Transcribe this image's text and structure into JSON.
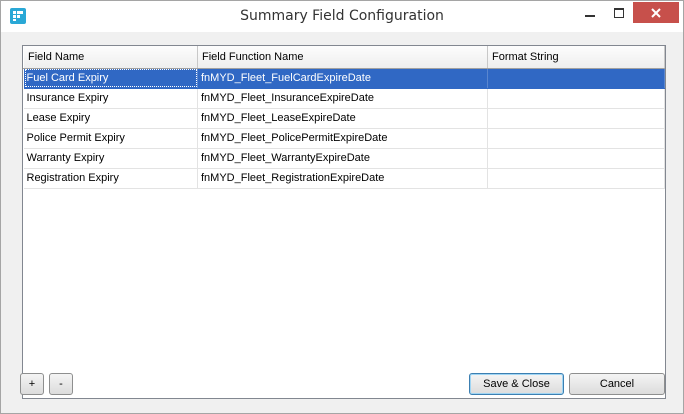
{
  "window": {
    "title": "Summary Field Configuration",
    "controls": [
      "minimize-icon",
      "maximize-icon",
      "close-icon"
    ],
    "close_button_color": "#c7504b"
  },
  "grid": {
    "columns": [
      "Field Name",
      "Field Function Name",
      "Format String"
    ],
    "rows": [
      {
        "field_name": "Fuel Card Expiry",
        "function_name": "fnMYD_Fleet_FuelCardExpireDate",
        "format": ""
      },
      {
        "field_name": "Insurance Expiry",
        "function_name": "fnMYD_Fleet_InsuranceExpireDate",
        "format": ""
      },
      {
        "field_name": "Lease Expiry",
        "function_name": "fnMYD_Fleet_LeaseExpireDate",
        "format": ""
      },
      {
        "field_name": "Police Permit Expiry",
        "function_name": "fnMYD_Fleet_PolicePermitExpireDate",
        "format": ""
      },
      {
        "field_name": "Warranty Expiry",
        "function_name": "fnMYD_Fleet_WarrantyExpireDate",
        "format": ""
      },
      {
        "field_name": "Registration Expiry",
        "function_name": "fnMYD_Fleet_RegistrationExpireDate",
        "format": ""
      }
    ],
    "selected_row": 0,
    "selection_color": "#3068c4"
  },
  "buttons": {
    "add": "+",
    "remove": "-",
    "save": "Save & Close",
    "cancel": "Cancel"
  }
}
